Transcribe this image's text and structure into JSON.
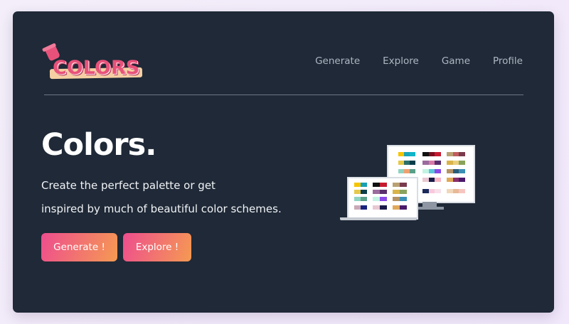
{
  "brand": {
    "logo_text": "COLORS",
    "logo_icon": "paint-bucket-icon"
  },
  "nav": {
    "items": [
      {
        "label": "Generate"
      },
      {
        "label": "Explore"
      },
      {
        "label": "Game"
      },
      {
        "label": "Profile"
      }
    ]
  },
  "hero": {
    "title": "Colors.",
    "line1": "Create the perfect palette or get",
    "line2": "inspired by much of beautiful color schemes."
  },
  "buttons": {
    "generate": "Generate !",
    "explore": "Explore !"
  },
  "colors": {
    "background": "#1f2937",
    "accent_start": "#ee4d8e",
    "accent_end": "#f59a52",
    "logo": "#e8527a"
  },
  "illustration": {
    "icon": "palette-monitors-icon"
  }
}
